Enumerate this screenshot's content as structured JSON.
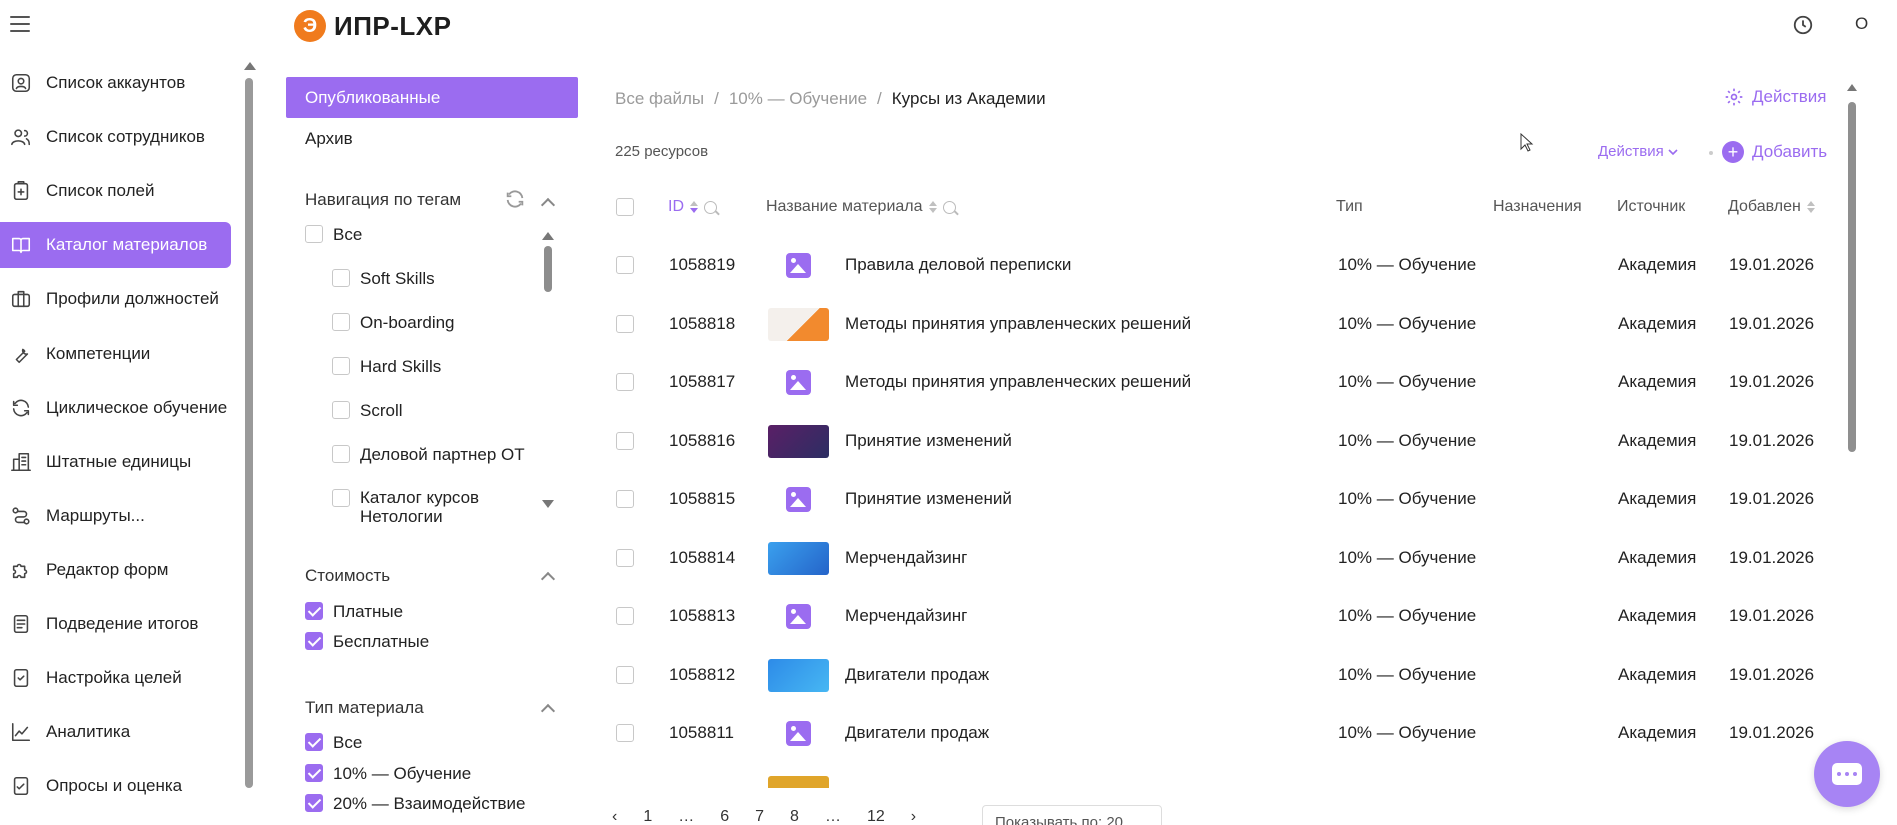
{
  "app": {
    "logo_letter": "Э",
    "title": "ИПР-LXP",
    "user_initial": "О"
  },
  "colors": {
    "accent": "#9b6cf0",
    "logo": "#f07b1d"
  },
  "sidebar": {
    "items": [
      {
        "label": "Список аккаунтов",
        "icon": "account-icon"
      },
      {
        "label": "Список сотрудников",
        "icon": "users-icon"
      },
      {
        "label": "Список полей",
        "icon": "clipboard-plus-icon"
      },
      {
        "label": "Каталог материалов",
        "icon": "book-icon",
        "active": true
      },
      {
        "label": "Профили должностей",
        "icon": "briefcase-icon"
      },
      {
        "label": "Компетенции",
        "icon": "wrench-icon"
      },
      {
        "label": "Циклическое обучение",
        "icon": "cycle-icon"
      },
      {
        "label": "Штатные единицы",
        "icon": "building-icon"
      },
      {
        "label": "Маршруты...",
        "icon": "route-icon"
      },
      {
        "label": "Редактор форм",
        "icon": "puzzle-icon"
      },
      {
        "label": "Подведение итогов",
        "icon": "report-icon"
      },
      {
        "label": "Настройка целей",
        "icon": "goal-check-icon"
      },
      {
        "label": "Аналитика",
        "icon": "chart-line-icon"
      },
      {
        "label": "Опросы и оценка",
        "icon": "survey-icon"
      }
    ]
  },
  "filters": {
    "tab_published": "Опубликованные",
    "tab_archive": "Архив",
    "tags_heading": "Навигация по тегам",
    "tags": [
      {
        "label": "Все",
        "checked": false,
        "indent": false
      },
      {
        "label": "Soft Skills",
        "checked": false,
        "indent": true
      },
      {
        "label": "On-boarding",
        "checked": false,
        "indent": true
      },
      {
        "label": "Hard Skills",
        "checked": false,
        "indent": true
      },
      {
        "label": "Scroll",
        "checked": false,
        "indent": true
      },
      {
        "label": "Деловой партнер ОТ",
        "checked": false,
        "indent": true
      },
      {
        "label": "Каталог курсов Нетологии",
        "checked": false,
        "indent": true
      }
    ],
    "cost_heading": "Стоимость",
    "cost": [
      {
        "label": "Платные",
        "checked": true
      },
      {
        "label": "Бесплатные",
        "checked": true
      }
    ],
    "type_heading": "Тип материала",
    "types": [
      {
        "label": "Все",
        "checked": true
      },
      {
        "label": "10% — Обучение",
        "checked": true
      },
      {
        "label": "20% — Взаимодействие",
        "checked": true
      }
    ]
  },
  "main": {
    "breadcrumb": [
      "Все файлы",
      "10% — Обучение",
      "Курсы из Академии"
    ],
    "breadcrumb_sep": "/",
    "actions_top": "Действия",
    "resource_count": "225 ресурсов",
    "actions_dropdown": "Действия",
    "add_label": "Добавить",
    "columns": {
      "id": "ID",
      "name": "Название материала",
      "type": "Тип",
      "assign": "Назначения",
      "source": "Источник",
      "added": "Добавлен"
    },
    "rows": [
      {
        "id": "1058819",
        "title": "Правила деловой переписки",
        "type": "10% — Обучение",
        "source": "Академия",
        "date": "19.01.2026",
        "thumb": "placeholder"
      },
      {
        "id": "1058818",
        "title": "Методы принятия управленческих решений",
        "type": "10% — Обучение",
        "source": "Академия",
        "date": "19.01.2026",
        "thumb": "img1"
      },
      {
        "id": "1058817",
        "title": "Методы принятия управленческих решений",
        "type": "10% — Обучение",
        "source": "Академия",
        "date": "19.01.2026",
        "thumb": "placeholder"
      },
      {
        "id": "1058816",
        "title": "Принятие изменений",
        "type": "10% — Обучение",
        "source": "Академия",
        "date": "19.01.2026",
        "thumb": "img2"
      },
      {
        "id": "1058815",
        "title": "Принятие изменений",
        "type": "10% — Обучение",
        "source": "Академия",
        "date": "19.01.2026",
        "thumb": "placeholder"
      },
      {
        "id": "1058814",
        "title": "Мерчендайзинг",
        "type": "10% — Обучение",
        "source": "Академия",
        "date": "19.01.2026",
        "thumb": "img3"
      },
      {
        "id": "1058813",
        "title": "Мерчендайзинг",
        "type": "10% — Обучение",
        "source": "Академия",
        "date": "19.01.2026",
        "thumb": "placeholder"
      },
      {
        "id": "1058812",
        "title": "Двигатели продаж",
        "type": "10% — Обучение",
        "source": "Академия",
        "date": "19.01.2026",
        "thumb": "img4"
      },
      {
        "id": "1058811",
        "title": "Двигатели продаж",
        "type": "10% — Обучение",
        "source": "Академия",
        "date": "19.01.2026",
        "thumb": "placeholder"
      }
    ],
    "pagination": [
      "‹",
      "1",
      "…",
      "6",
      "7",
      "8",
      "…",
      "12",
      "›"
    ],
    "per_page": "Показывать по: 20"
  }
}
